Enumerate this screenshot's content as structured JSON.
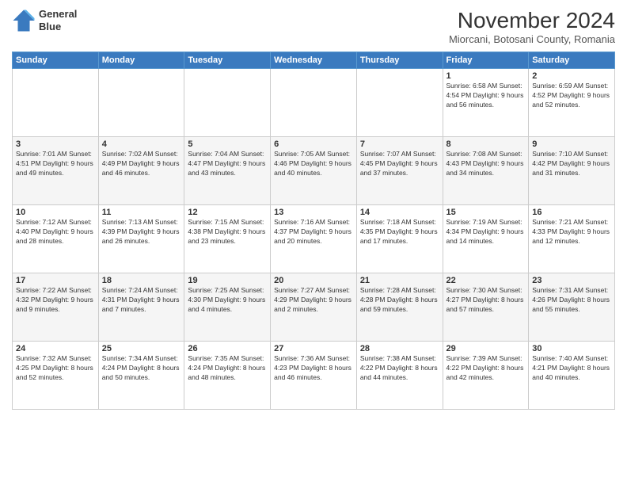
{
  "header": {
    "logo_line1": "General",
    "logo_line2": "Blue",
    "month_title": "November 2024",
    "subtitle": "Miorcani, Botosani County, Romania"
  },
  "weekdays": [
    "Sunday",
    "Monday",
    "Tuesday",
    "Wednesday",
    "Thursday",
    "Friday",
    "Saturday"
  ],
  "weeks": [
    [
      {
        "day": "",
        "info": ""
      },
      {
        "day": "",
        "info": ""
      },
      {
        "day": "",
        "info": ""
      },
      {
        "day": "",
        "info": ""
      },
      {
        "day": "",
        "info": ""
      },
      {
        "day": "1",
        "info": "Sunrise: 6:58 AM\nSunset: 4:54 PM\nDaylight: 9 hours and 56 minutes."
      },
      {
        "day": "2",
        "info": "Sunrise: 6:59 AM\nSunset: 4:52 PM\nDaylight: 9 hours and 52 minutes."
      }
    ],
    [
      {
        "day": "3",
        "info": "Sunrise: 7:01 AM\nSunset: 4:51 PM\nDaylight: 9 hours and 49 minutes."
      },
      {
        "day": "4",
        "info": "Sunrise: 7:02 AM\nSunset: 4:49 PM\nDaylight: 9 hours and 46 minutes."
      },
      {
        "day": "5",
        "info": "Sunrise: 7:04 AM\nSunset: 4:47 PM\nDaylight: 9 hours and 43 minutes."
      },
      {
        "day": "6",
        "info": "Sunrise: 7:05 AM\nSunset: 4:46 PM\nDaylight: 9 hours and 40 minutes."
      },
      {
        "day": "7",
        "info": "Sunrise: 7:07 AM\nSunset: 4:45 PM\nDaylight: 9 hours and 37 minutes."
      },
      {
        "day": "8",
        "info": "Sunrise: 7:08 AM\nSunset: 4:43 PM\nDaylight: 9 hours and 34 minutes."
      },
      {
        "day": "9",
        "info": "Sunrise: 7:10 AM\nSunset: 4:42 PM\nDaylight: 9 hours and 31 minutes."
      }
    ],
    [
      {
        "day": "10",
        "info": "Sunrise: 7:12 AM\nSunset: 4:40 PM\nDaylight: 9 hours and 28 minutes."
      },
      {
        "day": "11",
        "info": "Sunrise: 7:13 AM\nSunset: 4:39 PM\nDaylight: 9 hours and 26 minutes."
      },
      {
        "day": "12",
        "info": "Sunrise: 7:15 AM\nSunset: 4:38 PM\nDaylight: 9 hours and 23 minutes."
      },
      {
        "day": "13",
        "info": "Sunrise: 7:16 AM\nSunset: 4:37 PM\nDaylight: 9 hours and 20 minutes."
      },
      {
        "day": "14",
        "info": "Sunrise: 7:18 AM\nSunset: 4:35 PM\nDaylight: 9 hours and 17 minutes."
      },
      {
        "day": "15",
        "info": "Sunrise: 7:19 AM\nSunset: 4:34 PM\nDaylight: 9 hours and 14 minutes."
      },
      {
        "day": "16",
        "info": "Sunrise: 7:21 AM\nSunset: 4:33 PM\nDaylight: 9 hours and 12 minutes."
      }
    ],
    [
      {
        "day": "17",
        "info": "Sunrise: 7:22 AM\nSunset: 4:32 PM\nDaylight: 9 hours and 9 minutes."
      },
      {
        "day": "18",
        "info": "Sunrise: 7:24 AM\nSunset: 4:31 PM\nDaylight: 9 hours and 7 minutes."
      },
      {
        "day": "19",
        "info": "Sunrise: 7:25 AM\nSunset: 4:30 PM\nDaylight: 9 hours and 4 minutes."
      },
      {
        "day": "20",
        "info": "Sunrise: 7:27 AM\nSunset: 4:29 PM\nDaylight: 9 hours and 2 minutes."
      },
      {
        "day": "21",
        "info": "Sunrise: 7:28 AM\nSunset: 4:28 PM\nDaylight: 8 hours and 59 minutes."
      },
      {
        "day": "22",
        "info": "Sunrise: 7:30 AM\nSunset: 4:27 PM\nDaylight: 8 hours and 57 minutes."
      },
      {
        "day": "23",
        "info": "Sunrise: 7:31 AM\nSunset: 4:26 PM\nDaylight: 8 hours and 55 minutes."
      }
    ],
    [
      {
        "day": "24",
        "info": "Sunrise: 7:32 AM\nSunset: 4:25 PM\nDaylight: 8 hours and 52 minutes."
      },
      {
        "day": "25",
        "info": "Sunrise: 7:34 AM\nSunset: 4:24 PM\nDaylight: 8 hours and 50 minutes."
      },
      {
        "day": "26",
        "info": "Sunrise: 7:35 AM\nSunset: 4:24 PM\nDaylight: 8 hours and 48 minutes."
      },
      {
        "day": "27",
        "info": "Sunrise: 7:36 AM\nSunset: 4:23 PM\nDaylight: 8 hours and 46 minutes."
      },
      {
        "day": "28",
        "info": "Sunrise: 7:38 AM\nSunset: 4:22 PM\nDaylight: 8 hours and 44 minutes."
      },
      {
        "day": "29",
        "info": "Sunrise: 7:39 AM\nSunset: 4:22 PM\nDaylight: 8 hours and 42 minutes."
      },
      {
        "day": "30",
        "info": "Sunrise: 7:40 AM\nSunset: 4:21 PM\nDaylight: 8 hours and 40 minutes."
      }
    ]
  ]
}
